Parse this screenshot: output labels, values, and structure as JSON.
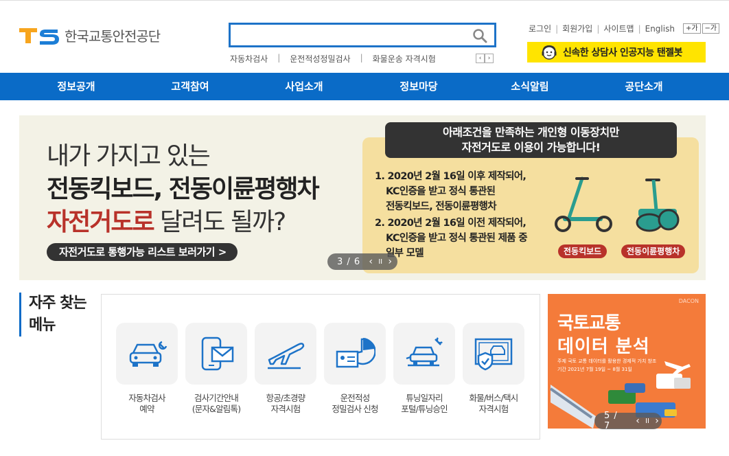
{
  "header": {
    "logo_text": "한국교통안전공단",
    "search": {
      "value": "",
      "placeholder": ""
    },
    "quick_links": [
      "자동차검사",
      "운전적성정밀검사",
      "화물운송 자격시험"
    ],
    "util_links": [
      "로그인",
      "회원가입",
      "사이트맵",
      "English"
    ],
    "font_increase": "+가",
    "font_decrease": "−가",
    "chatbot_label": "신속한 상담사 인공지능 탠젤봇"
  },
  "gnb": [
    "정보공개",
    "고객참여",
    "사업소개",
    "정보마당",
    "소식알림",
    "공단소개"
  ],
  "banner": {
    "line1": "내가 가지고 있는",
    "line2": "전동킥보드, 전동이륜평행차",
    "line3_red": "자전거도로",
    "line3_rest": " 달려도 될까?",
    "list_button": "자전거도로 통행가능 리스트 보러가기 >",
    "condition_title_1": "아래조건을 만족하는 개인형 이동장치만",
    "condition_title_2": "자전거도로 이용이 가능합니다!",
    "item1_a": "1. 2020년 2월 16일 이후 제작되어,",
    "item1_b": "KC인증을 받고 정식 통관된",
    "item1_c": "전동킥보드, 전동이륜평행차",
    "item2_a": "2. 2020년 2월 16일 이전 제작되어,",
    "item2_b": "KC인증을 받고 정식 통관된 제품 중",
    "item2_c": "일부 모델",
    "tag_kickboard": "전동킥보드",
    "tag_segway": "전동이륜평행차",
    "pager": "3 / 6"
  },
  "frequent_menu": {
    "title_line1": "자주 찾는",
    "title_line2": "메뉴",
    "items": [
      {
        "label1": "자동차검사",
        "label2": "예약",
        "icon": "car-wrench-icon"
      },
      {
        "label1": "검사기간안내",
        "label2": "(문자&알림톡)",
        "icon": "phone-mail-icon"
      },
      {
        "label1": "항공/초경량",
        "label2": "자격시험",
        "icon": "airplane-icon"
      },
      {
        "label1": "운전적성",
        "label2": "정밀검사 신청",
        "icon": "id-chart-icon"
      },
      {
        "label1": "튜닝일자리",
        "label2": "포털/튜닝승인",
        "icon": "car-tools-icon"
      },
      {
        "label1": "화물/버스/택시",
        "label2": "자격시험",
        "icon": "certificate-shield-icon"
      }
    ]
  },
  "side_banner": {
    "brand": "DACON",
    "title1": "국토교통",
    "title2": "데이터 분석",
    "small1": "주제  국토 교통 데이터를 활용한 경제적 가치 창조",
    "small2": "기간  2021년 7월 19일 ~ 8월 31일",
    "pager": "5 / 7"
  },
  "colors": {
    "primary": "#0a6bc7",
    "chatbot": "#ffe400",
    "banner_red": "#b8322a",
    "side_banner": "#f47b3a"
  }
}
